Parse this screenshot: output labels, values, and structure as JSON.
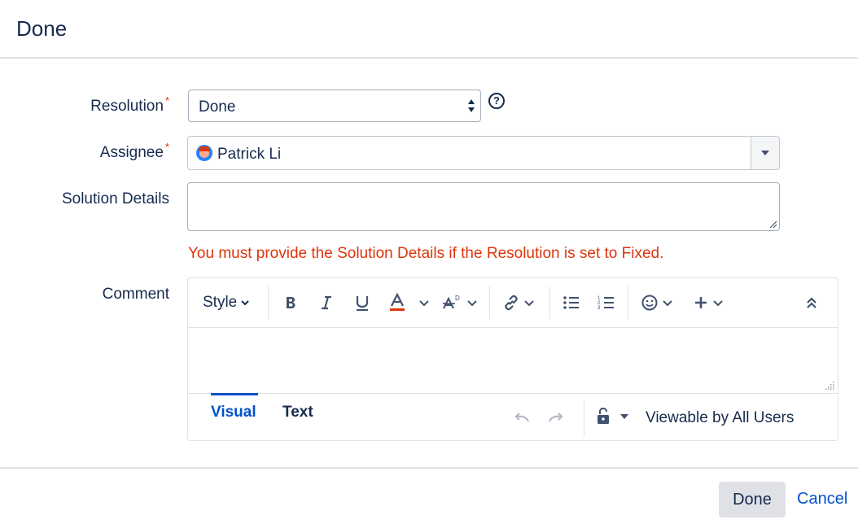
{
  "dialog": {
    "title": "Done"
  },
  "form": {
    "resolution": {
      "label": "Resolution",
      "required_mark": "*",
      "value": "Done"
    },
    "assignee": {
      "label": "Assignee",
      "required_mark": "*",
      "value": "Patrick Li"
    },
    "solution_details": {
      "label": "Solution Details",
      "value": ""
    },
    "error_message": "You must provide the Solution Details if the Resolution is set to Fixed.",
    "comment": {
      "label": "Comment"
    }
  },
  "editor": {
    "toolbar": {
      "style_label": "Style",
      "items": [
        "bold-icon",
        "italic-icon",
        "underline-icon",
        "text-color-icon",
        "text-effects-icon",
        "link-icon",
        "bullet-list-icon",
        "numbered-list-icon",
        "emoji-icon",
        "insert-icon",
        "collapse-icon"
      ]
    },
    "tabs": {
      "visual": "Visual",
      "text": "Text"
    },
    "active_tab": "Visual",
    "visibility": "Viewable by All Users"
  },
  "footer": {
    "done_label": "Done",
    "cancel_label": "Cancel"
  },
  "colors": {
    "link": "#0052cc",
    "error": "#de350b",
    "text": "#172b4d",
    "text_color_underline": "#de350b"
  }
}
